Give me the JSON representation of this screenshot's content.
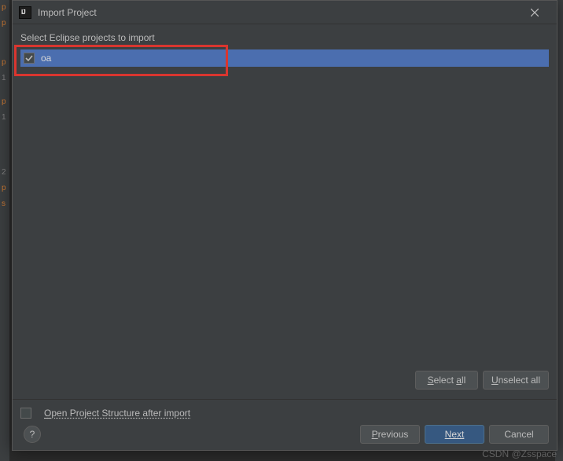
{
  "dialog": {
    "title": "Import Project",
    "instruction": "Select Eclipse projects to import"
  },
  "projects": {
    "items": [
      {
        "name": "oa",
        "checked": true,
        "selected": true
      }
    ]
  },
  "buttons": {
    "select_all": "Select all",
    "unselect_all": "Unselect all",
    "previous": "Previous",
    "next": "Next",
    "cancel": "Cancel"
  },
  "options": {
    "open_structure_prefix": "O",
    "open_structure_rest": "pen Project Structure after import",
    "open_structure_checked": false
  },
  "help": {
    "label": "?"
  },
  "watermark": "CSDN @Zsspace"
}
